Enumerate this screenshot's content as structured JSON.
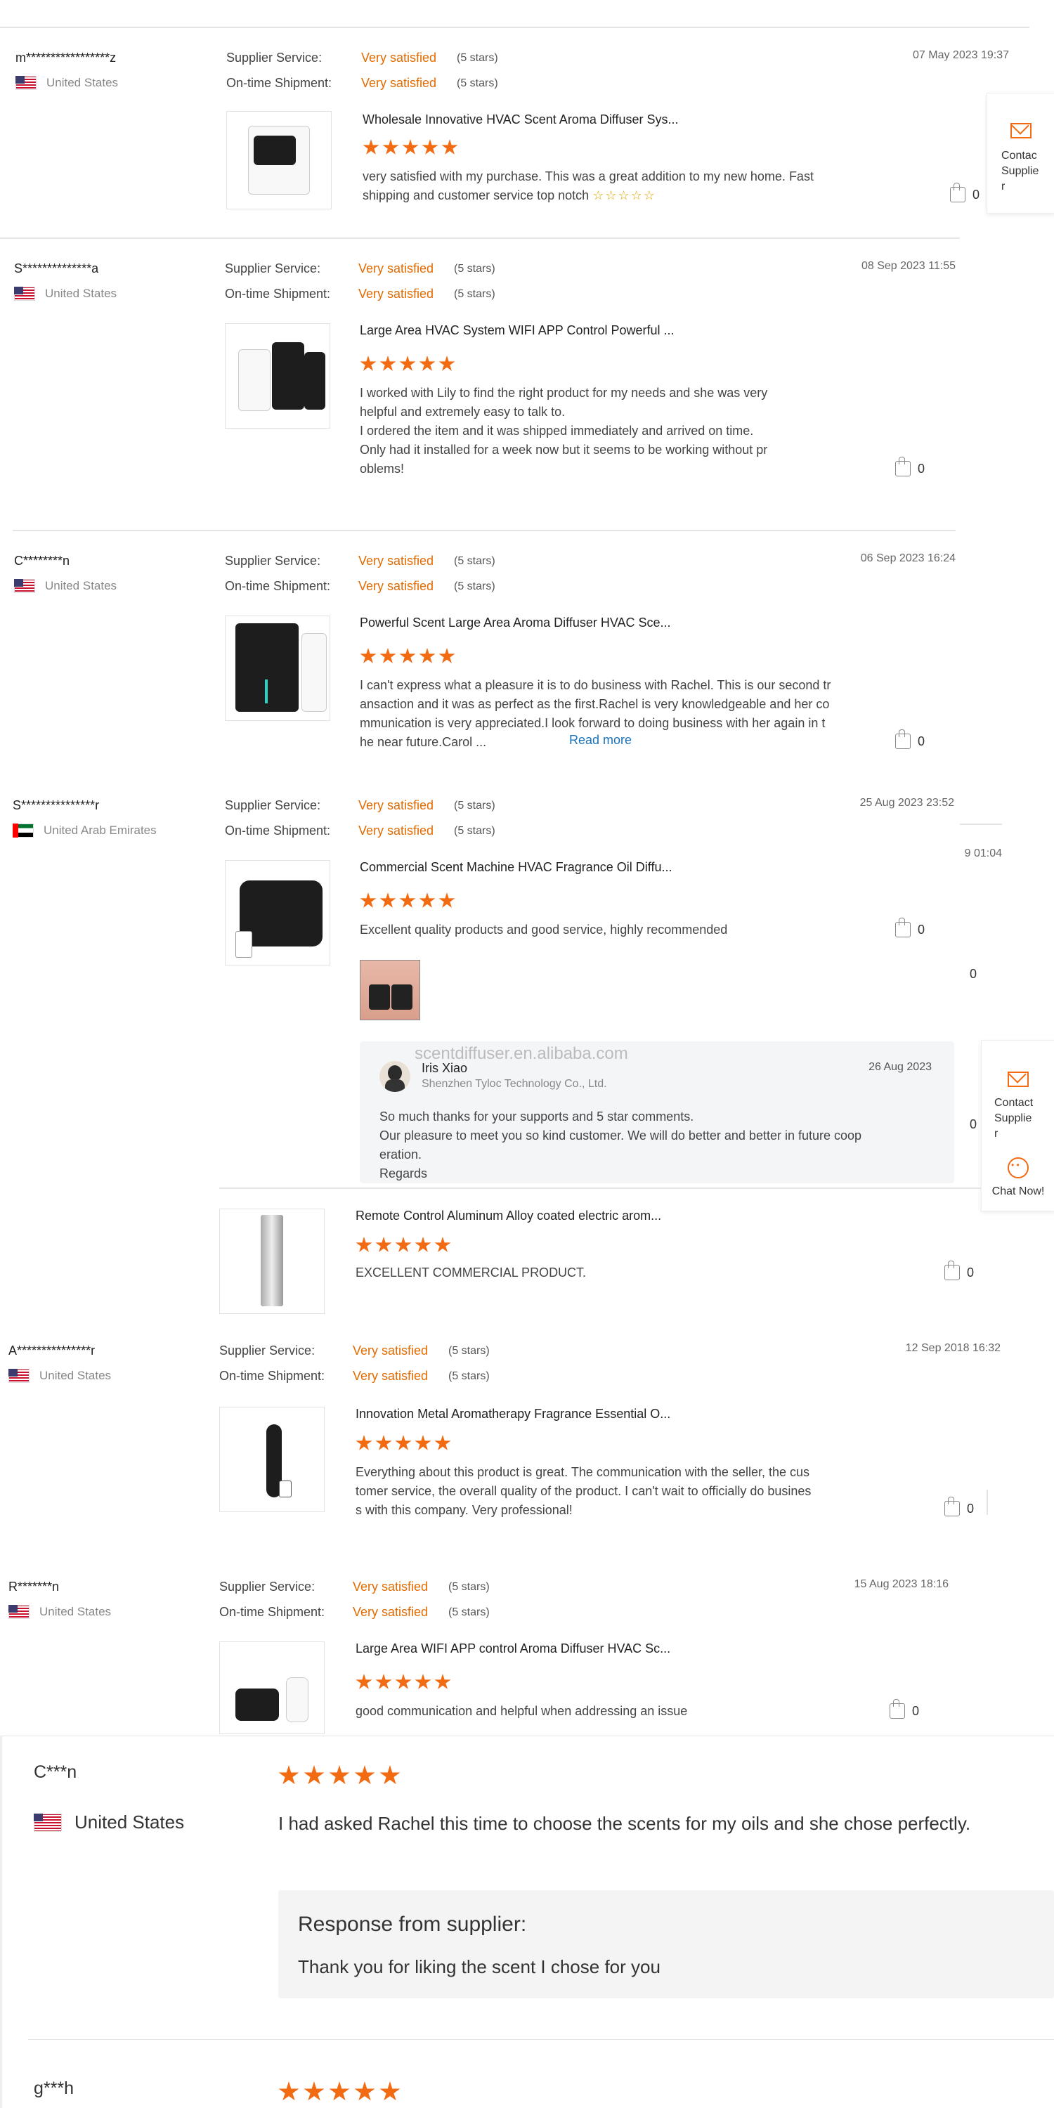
{
  "review_labels": {
    "service": "Supplier Service:",
    "shipment": "On-time Shipment:",
    "satisfaction": "Very satisfied",
    "stars_text": "(5 stars)"
  },
  "reviews": [
    {
      "user": "m*****************z",
      "country": "United States",
      "date": "07 May 2023 19:37",
      "product": "Wholesale Innovative HVAC Scent Aroma Diffuser Sys...",
      "text": "very satisfied with my purchase. This was a great addition to my new home. Fast\nshipping and customer service top notch",
      "likes": "0"
    },
    {
      "user": "S**************a",
      "country": "United States",
      "date": "08 Sep 2023 11:55",
      "product": "Large Area HVAC System WIFI APP Control Powerful ...",
      "text": "I worked with Lily to find the right product for my needs and she was very\nhelpful and extremely easy to talk to.\nI ordered the item and it was shipped immediately and arrived on time.\nOnly had it installed for a week now but it seems to be working without pr\noblems!",
      "likes": "0"
    },
    {
      "user": "C********n",
      "country": "United States",
      "date": "06 Sep 2023 16:24",
      "product": "Powerful Scent Large Area Aroma Diffuser HVAC Sce...",
      "text": "I can't express what a pleasure it is to do business with Rachel. This is our second tr\nansaction and it was as perfect as the first.Rachel is very knowledgeable and her co\nmmunication is very appreciated.I look forward to doing business with her again in t\nhe near future.Carol ...",
      "read_more": "Read more",
      "likes": "0"
    },
    {
      "user": "S***************r",
      "country": "United Arab Emirates",
      "date": "25 Aug 2023 23:52",
      "product": "Commercial Scent Machine HVAC Fragrance Oil Diffu...",
      "text": "Excellent quality products and good service, highly recommended",
      "likes": "0"
    },
    {
      "product": "Remote Control Aluminum Alloy coated electric arom...",
      "text": "EXCELLENT COMMERCIAL PRODUCT.",
      "likes": "0"
    },
    {
      "user": "A***************r",
      "country": "United States",
      "date": "12 Sep 2018 16:32",
      "product": "Innovation Metal Aromatherapy Fragrance Essential O...",
      "text": "Everything about this product is great. The communication with the seller, the cus\ntomer service, the overall quality of the product. I can't wait to officially do busines\ns with this company. Very professional!",
      "likes": "0"
    },
    {
      "user": "R*******n",
      "country": "United States",
      "date": "15 Aug 2023 18:16",
      "product": "Large Area WIFI APP control Aroma Diffuser HVAC Sc...",
      "text": "good communication and helpful when addressing an issue",
      "likes": "0"
    }
  ],
  "supplier_reply": {
    "name": "Iris Xiao",
    "company": "Shenzhen Tyloc Technology Co., Ltd.",
    "date": "26 Aug 2023",
    "text": "So much thanks for your supports and 5 star comments.\nOur pleasure to meet you so kind customer. We will do better and better in future coop\neration.\nRegards",
    "watermark": "scentdiffuser.en.alibaba.com"
  },
  "partial_fragments": {
    "date_fragment": "9 01:04",
    "zero_a": "0",
    "zero_b": "0"
  },
  "sidebar": {
    "contact_top": "Contac\nSupplie\nr",
    "contact": "Contact\nSupplie\nr",
    "chat": "Chat Now!"
  },
  "bottom_reviews": [
    {
      "user": "C***n",
      "country": "United States",
      "text": "I had asked Rachel this time to choose the scents for my oils and she chose perfectly.",
      "response_title": "Response from supplier:",
      "response_text": "Thank you for liking the scent I chose for you"
    },
    {
      "user": "g***h"
    }
  ]
}
